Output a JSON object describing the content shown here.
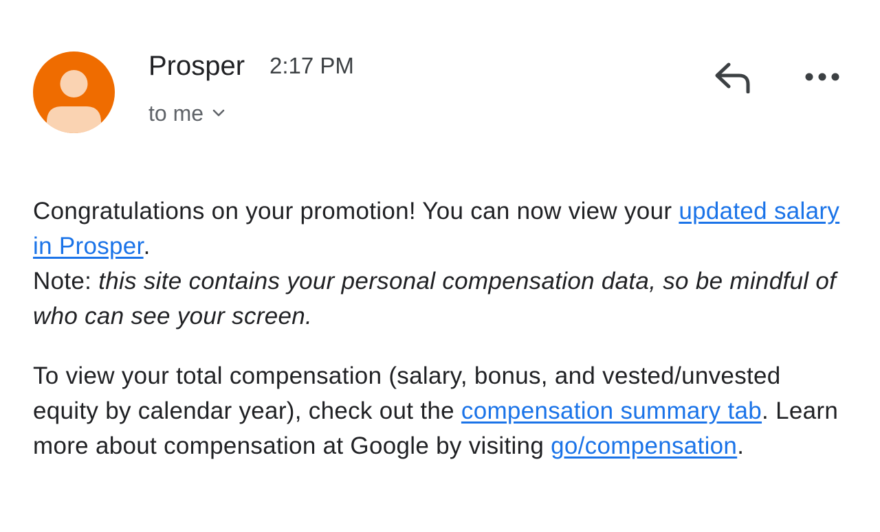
{
  "header": {
    "sender_name": "Prosper",
    "time": "2:17 PM",
    "recipient_label": "to me",
    "avatar_icon": "person-avatar-icon",
    "reply_icon": "reply-icon",
    "more_icon": "more-horiz-icon",
    "expand_icon": "chevron-down-icon"
  },
  "colors": {
    "avatar_bg": "#ef6c00",
    "avatar_figure": "#fad3b2",
    "link": "#1a73e8",
    "text": "#202124",
    "secondary_text": "#5f6368"
  },
  "message": {
    "p1": {
      "intro": "Congratulations on your promotion! You can now view your ",
      "link_salary": "updated salary in Prosper",
      "after_link": ".",
      "note_label": "Note: ",
      "note_text": "this site contains your personal compensation data, so be mindful of who can see your screen."
    },
    "p2": {
      "intro": "To view your total compensation (salary, bonus, and vested/unvested equity by calendar year), check out the ",
      "link_summary": "compensation summary tab",
      "middle": ". Learn more about compensation at Google by visiting ",
      "link_go": "go/compensation",
      "end": "."
    }
  }
}
